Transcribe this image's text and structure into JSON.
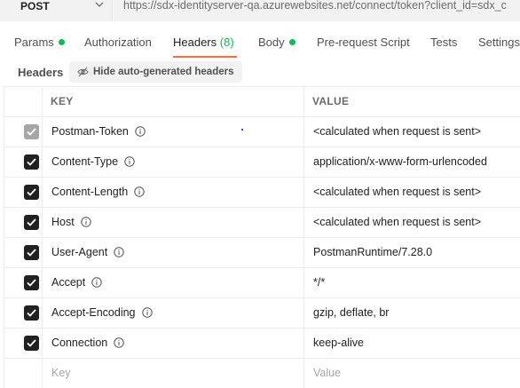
{
  "request": {
    "method": "POST",
    "url": "https://sdx-identityserver-qa.azurewebsites.net/connect/token?client_id=sdx_c"
  },
  "tabs": [
    {
      "label": "Params",
      "dot": true
    },
    {
      "label": "Authorization",
      "dot": false
    },
    {
      "label": "Headers",
      "count": "(8)",
      "active": true
    },
    {
      "label": "Body",
      "dot": true
    },
    {
      "label": "Pre-request Script",
      "dot": false
    },
    {
      "label": "Tests",
      "dot": false
    },
    {
      "label": "Settings",
      "dot": false
    }
  ],
  "headers_section": {
    "title": "Headers",
    "hide_button_label": "Hide auto-generated headers"
  },
  "table": {
    "columns": {
      "key": "KEY",
      "value": "VALUE"
    },
    "rows": [
      {
        "key": "Postman-Token",
        "value": "<calculated when request is sent>",
        "checked": true,
        "disabled": true
      },
      {
        "key": "Content-Type",
        "value": "application/x-www-form-urlencoded",
        "checked": true,
        "disabled": false
      },
      {
        "key": "Content-Length",
        "value": "<calculated when request is sent>",
        "checked": true,
        "disabled": false
      },
      {
        "key": "Host",
        "value": "<calculated when request is sent>",
        "checked": true,
        "disabled": false
      },
      {
        "key": "User-Agent",
        "value": "PostmanRuntime/7.28.0",
        "checked": true,
        "disabled": false
      },
      {
        "key": "Accept",
        "value": "*/*",
        "checked": true,
        "disabled": false
      },
      {
        "key": "Accept-Encoding",
        "value": "gzip, deflate, br",
        "checked": true,
        "disabled": false
      },
      {
        "key": "Connection",
        "value": "keep-alive",
        "checked": true,
        "disabled": false
      }
    ],
    "new_row": {
      "key_placeholder": "Key",
      "value_placeholder": "Value"
    }
  },
  "colors": {
    "accent": "#ff6c37",
    "status_green": "#0cbb52"
  }
}
